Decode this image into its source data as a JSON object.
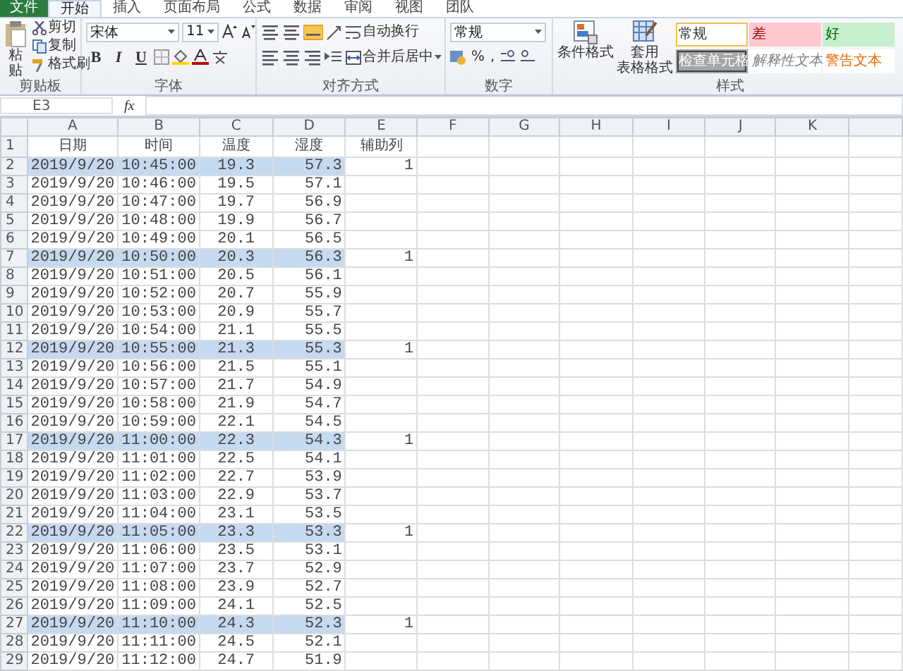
{
  "tabs": [
    {
      "label": "文件",
      "kind": "file",
      "selected": false
    },
    {
      "label": "开始",
      "kind": "tab",
      "selected": true
    },
    {
      "label": "插入",
      "kind": "tab",
      "selected": false
    },
    {
      "label": "页面布局",
      "kind": "tab",
      "selected": false
    },
    {
      "label": "公式",
      "kind": "tab",
      "selected": false
    },
    {
      "label": "数据",
      "kind": "tab",
      "selected": false
    },
    {
      "label": "审阅",
      "kind": "tab",
      "selected": false
    },
    {
      "label": "视图",
      "kind": "tab",
      "selected": false
    },
    {
      "label": "团队",
      "kind": "tab",
      "selected": false
    }
  ],
  "clipboard": {
    "paste": "粘贴",
    "cut": "剪切",
    "copy": "复制",
    "format_painter": "格式刷",
    "label": "剪贴板"
  },
  "font": {
    "name": "宋体",
    "size": "11",
    "bold": "B",
    "italic": "I",
    "underline": "U",
    "label": "字体"
  },
  "alignment": {
    "wrap": "自动换行",
    "merge": "合并后居中",
    "label": "对齐方式"
  },
  "number": {
    "format": "常规",
    "percent": "%",
    "comma": ",",
    "label": "数字"
  },
  "styles": {
    "conditional": "条件格式",
    "table_format": [
      "套用",
      "表格格式"
    ],
    "label": "样式",
    "cells": [
      {
        "label": "常规",
        "kind": "normal",
        "selected": true
      },
      {
        "label": "差",
        "kind": "bad",
        "selected": false
      },
      {
        "label": "好",
        "kind": "good",
        "selected": false
      },
      {
        "label": "检查单元格",
        "kind": "check",
        "selected": false
      },
      {
        "label": "解释性文本",
        "kind": "explanatory",
        "selected": false
      },
      {
        "label": "警告文本",
        "kind": "warning",
        "selected": false
      }
    ]
  },
  "formula_bar": {
    "name_box": "E3",
    "function_label": "fx"
  },
  "sheet": {
    "columns": [
      "A",
      "B",
      "C",
      "D",
      "E",
      "F",
      "G",
      "H",
      "I",
      "J",
      "K"
    ],
    "rows": [
      {
        "num": "1",
        "kind": "header",
        "highlighted": false,
        "cells": [
          "日期",
          "时间",
          "温度",
          "湿度",
          "辅助列"
        ]
      },
      {
        "num": "2",
        "kind": "data",
        "highlighted": true,
        "cells": [
          "2019/9/20",
          "10:45:00",
          "19.3",
          "57.3",
          "1"
        ]
      },
      {
        "num": "3",
        "kind": "data",
        "highlighted": false,
        "cells": [
          "2019/9/20",
          "10:46:00",
          "19.5",
          "57.1"
        ]
      },
      {
        "num": "4",
        "kind": "data",
        "highlighted": false,
        "cells": [
          "2019/9/20",
          "10:47:00",
          "19.7",
          "56.9"
        ]
      },
      {
        "num": "5",
        "kind": "data",
        "highlighted": false,
        "cells": [
          "2019/9/20",
          "10:48:00",
          "19.9",
          "56.7"
        ]
      },
      {
        "num": "6",
        "kind": "data",
        "highlighted": false,
        "cells": [
          "2019/9/20",
          "10:49:00",
          "20.1",
          "56.5"
        ]
      },
      {
        "num": "7",
        "kind": "data",
        "highlighted": true,
        "cells": [
          "2019/9/20",
          "10:50:00",
          "20.3",
          "56.3",
          "1"
        ]
      },
      {
        "num": "8",
        "kind": "data",
        "highlighted": false,
        "cells": [
          "2019/9/20",
          "10:51:00",
          "20.5",
          "56.1"
        ]
      },
      {
        "num": "9",
        "kind": "data",
        "highlighted": false,
        "cells": [
          "2019/9/20",
          "10:52:00",
          "20.7",
          "55.9"
        ]
      },
      {
        "num": "10",
        "kind": "data",
        "highlighted": false,
        "cells": [
          "2019/9/20",
          "10:53:00",
          "20.9",
          "55.7"
        ]
      },
      {
        "num": "11",
        "kind": "data",
        "highlighted": false,
        "cells": [
          "2019/9/20",
          "10:54:00",
          "21.1",
          "55.5"
        ]
      },
      {
        "num": "12",
        "kind": "data",
        "highlighted": true,
        "cells": [
          "2019/9/20",
          "10:55:00",
          "21.3",
          "55.3",
          "1"
        ]
      },
      {
        "num": "13",
        "kind": "data",
        "highlighted": false,
        "cells": [
          "2019/9/20",
          "10:56:00",
          "21.5",
          "55.1"
        ]
      },
      {
        "num": "14",
        "kind": "data",
        "highlighted": false,
        "cells": [
          "2019/9/20",
          "10:57:00",
          "21.7",
          "54.9"
        ]
      },
      {
        "num": "15",
        "kind": "data",
        "highlighted": false,
        "cells": [
          "2019/9/20",
          "10:58:00",
          "21.9",
          "54.7"
        ]
      },
      {
        "num": "16",
        "kind": "data",
        "highlighted": false,
        "cells": [
          "2019/9/20",
          "10:59:00",
          "22.1",
          "54.5"
        ]
      },
      {
        "num": "17",
        "kind": "data",
        "highlighted": true,
        "cells": [
          "2019/9/20",
          "11:00:00",
          "22.3",
          "54.3",
          "1"
        ]
      },
      {
        "num": "18",
        "kind": "data",
        "highlighted": false,
        "cells": [
          "2019/9/20",
          "11:01:00",
          "22.5",
          "54.1"
        ]
      },
      {
        "num": "19",
        "kind": "data",
        "highlighted": false,
        "cells": [
          "2019/9/20",
          "11:02:00",
          "22.7",
          "53.9"
        ]
      },
      {
        "num": "20",
        "kind": "data",
        "highlighted": false,
        "cells": [
          "2019/9/20",
          "11:03:00",
          "22.9",
          "53.7"
        ]
      },
      {
        "num": "21",
        "kind": "data",
        "highlighted": false,
        "cells": [
          "2019/9/20",
          "11:04:00",
          "23.1",
          "53.5"
        ]
      },
      {
        "num": "22",
        "kind": "data",
        "highlighted": true,
        "cells": [
          "2019/9/20",
          "11:05:00",
          "23.3",
          "53.3",
          "1"
        ]
      },
      {
        "num": "23",
        "kind": "data",
        "highlighted": false,
        "cells": [
          "2019/9/20",
          "11:06:00",
          "23.5",
          "53.1"
        ]
      },
      {
        "num": "24",
        "kind": "data",
        "highlighted": false,
        "cells": [
          "2019/9/20",
          "11:07:00",
          "23.7",
          "52.9"
        ]
      },
      {
        "num": "25",
        "kind": "data",
        "highlighted": false,
        "cells": [
          "2019/9/20",
          "11:08:00",
          "23.9",
          "52.7"
        ]
      },
      {
        "num": "26",
        "kind": "data",
        "highlighted": false,
        "cells": [
          "2019/9/20",
          "11:09:00",
          "24.1",
          "52.5"
        ]
      },
      {
        "num": "27",
        "kind": "data",
        "highlighted": true,
        "cells": [
          "2019/9/20",
          "11:10:00",
          "24.3",
          "52.3",
          "1"
        ]
      },
      {
        "num": "28",
        "kind": "data",
        "highlighted": false,
        "cells": [
          "2019/9/20",
          "11:11:00",
          "24.5",
          "52.1"
        ]
      },
      {
        "num": "29",
        "kind": "data",
        "highlighted": false,
        "cells": [
          "2019/9/20",
          "11:12:00",
          "24.7",
          "51.9"
        ]
      }
    ]
  }
}
